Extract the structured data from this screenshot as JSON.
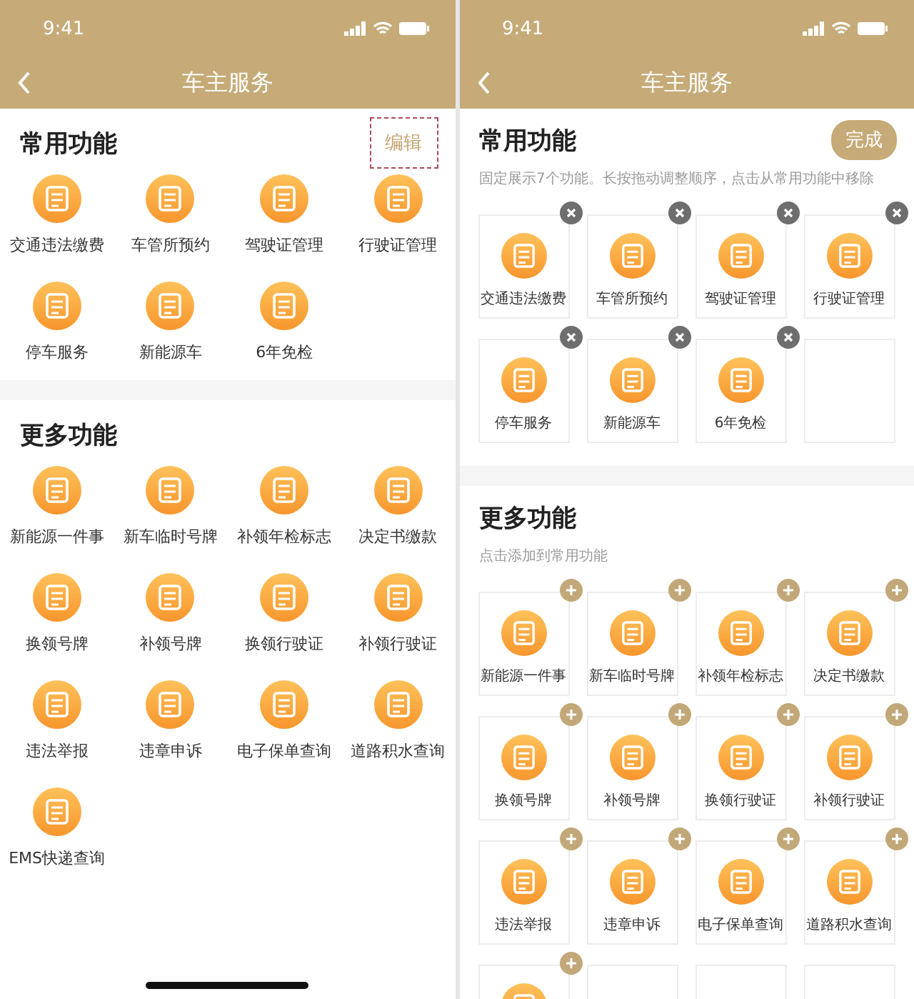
{
  "panels": [
    {
      "kind": "view",
      "status_bar": {
        "time": "9:41"
      },
      "nav": {
        "title": "车主服务"
      },
      "home_indicator": true,
      "sections": [
        {
          "title": "常用功能",
          "action": {
            "label": "编辑",
            "kind": "text",
            "highlighted": true
          },
          "items": [
            {
              "kind": "service",
              "label": "交通违法缴费"
            },
            {
              "kind": "service",
              "label": "车管所预约"
            },
            {
              "kind": "service",
              "label": "驾驶证管理"
            },
            {
              "kind": "service",
              "label": "行驶证管理"
            },
            {
              "kind": "service",
              "label": "停车服务"
            },
            {
              "kind": "service",
              "label": "新能源车"
            },
            {
              "kind": "service",
              "label": "6年免检"
            }
          ]
        },
        {
          "title": "更多功能",
          "items": [
            {
              "kind": "service",
              "label": "新能源一件事"
            },
            {
              "kind": "service",
              "label": "新车临时号牌"
            },
            {
              "kind": "service",
              "label": "补领年检标志"
            },
            {
              "kind": "service",
              "label": "决定书缴款"
            },
            {
              "kind": "service",
              "label": "换领号牌"
            },
            {
              "kind": "service",
              "label": "补领号牌"
            },
            {
              "kind": "service",
              "label": "换领行驶证"
            },
            {
              "kind": "service",
              "label": "补领行驶证"
            },
            {
              "kind": "service",
              "label": "违法举报"
            },
            {
              "kind": "service",
              "label": "违章申诉"
            },
            {
              "kind": "service",
              "label": "电子保单查询"
            },
            {
              "kind": "service",
              "label": "道路积水查询"
            },
            {
              "kind": "service",
              "label": "EMS快递查询"
            }
          ]
        }
      ]
    },
    {
      "kind": "edit",
      "status_bar": {
        "time": "9:41"
      },
      "nav": {
        "title": "车主服务"
      },
      "home_indicator": false,
      "sections": [
        {
          "title": "常用功能",
          "action": {
            "label": "完成",
            "kind": "pill",
            "highlighted": false
          },
          "hint": "固定展示7个功能。长按拖动调整顺序，点击从常用功能中移除",
          "items": [
            {
              "kind": "removable",
              "label": "交通违法缴费"
            },
            {
              "kind": "removable",
              "label": "车管所预约"
            },
            {
              "kind": "removable",
              "label": "驾驶证管理"
            },
            {
              "kind": "removable",
              "label": "行驶证管理"
            },
            {
              "kind": "removable",
              "label": "停车服务"
            },
            {
              "kind": "removable",
              "label": "新能源车"
            },
            {
              "kind": "removable",
              "label": "6年免检"
            },
            {
              "kind": "empty"
            }
          ]
        },
        {
          "title": "更多功能",
          "hint": "点击添加到常用功能",
          "items": [
            {
              "kind": "addable",
              "label": "新能源一件事"
            },
            {
              "kind": "addable",
              "label": "新车临时号牌"
            },
            {
              "kind": "addable",
              "label": "补领年检标志"
            },
            {
              "kind": "addable",
              "label": "决定书缴款"
            },
            {
              "kind": "addable",
              "label": "换领号牌"
            },
            {
              "kind": "addable",
              "label": "补领号牌"
            },
            {
              "kind": "addable",
              "label": "换领行驶证"
            },
            {
              "kind": "addable",
              "label": "补领行驶证"
            },
            {
              "kind": "addable",
              "label": "违法举报"
            },
            {
              "kind": "addable",
              "label": "违章申诉"
            },
            {
              "kind": "addable",
              "label": "电子保单查询"
            },
            {
              "kind": "addable",
              "label": "道路积水查询"
            },
            {
              "kind": "addable"
            },
            {
              "kind": "empty"
            },
            {
              "kind": "empty"
            },
            {
              "kind": "empty"
            }
          ]
        }
      ]
    }
  ]
}
